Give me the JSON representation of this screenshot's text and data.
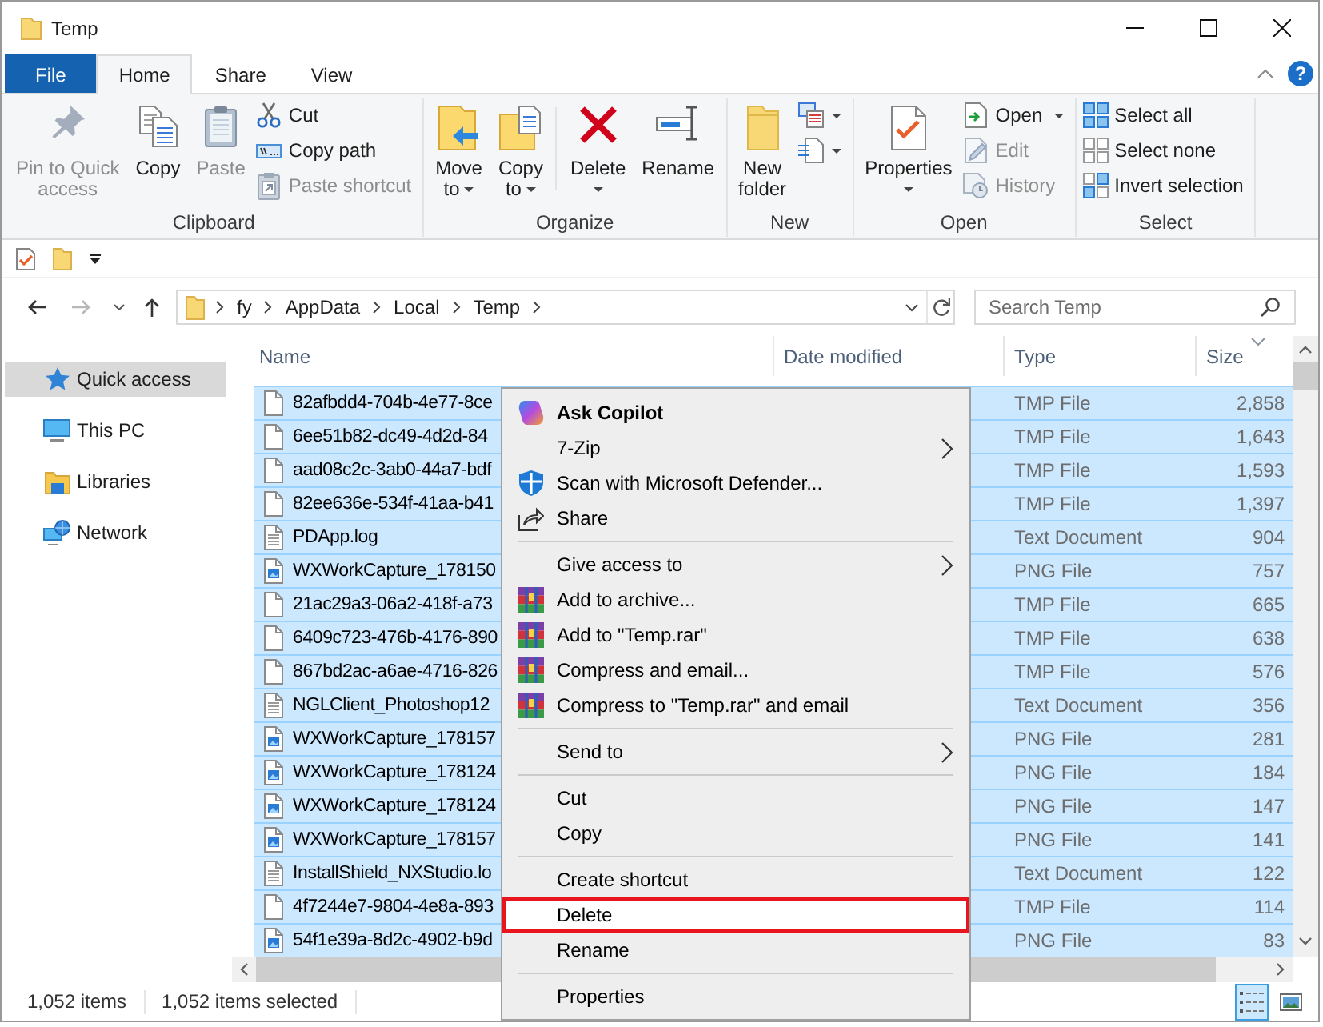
{
  "window": {
    "title": "Temp"
  },
  "ribbon": {
    "tabs": [
      {
        "label": "File",
        "kind": "menu",
        "selected": false
      },
      {
        "label": "Home",
        "kind": "tab",
        "selected": true
      },
      {
        "label": "Share",
        "kind": "tab",
        "selected": false
      },
      {
        "label": "View",
        "kind": "tab",
        "selected": false
      }
    ],
    "help": "?",
    "groups": [
      {
        "label": "Clipboard",
        "controls": [
          {
            "kind": "large",
            "label": "Pin to Quick access",
            "disabled": true
          },
          {
            "kind": "large",
            "label": "Copy",
            "disabled": false
          },
          {
            "kind": "large",
            "label": "Paste",
            "disabled": true
          },
          {
            "kind": "stack",
            "items": [
              {
                "label": "Cut",
                "disabled": false
              },
              {
                "label": "Copy path",
                "disabled": false
              },
              {
                "label": "Paste shortcut",
                "disabled": true
              }
            ]
          }
        ]
      },
      {
        "label": "Organize",
        "controls": [
          {
            "kind": "large",
            "label": "Move to",
            "dropdown": true,
            "disabled": false
          },
          {
            "kind": "large",
            "label": "Copy to",
            "dropdown": true,
            "disabled": false
          },
          {
            "kind": "divider"
          },
          {
            "kind": "large",
            "label": "Delete",
            "dropdown": true,
            "disabled": false
          },
          {
            "kind": "large",
            "label": "Rename",
            "dropdown": false,
            "disabled": false
          }
        ]
      },
      {
        "label": "New",
        "controls": [
          {
            "kind": "large",
            "label": "New folder",
            "dropdown": false,
            "disabled": false
          },
          {
            "kind": "icons",
            "items": [
              {
                "dropdown": true
              },
              {
                "dropdown": true
              }
            ]
          }
        ]
      },
      {
        "label": "Open",
        "controls": [
          {
            "kind": "large",
            "label": "Properties",
            "dropdown": true,
            "disabled": false
          },
          {
            "kind": "stack",
            "items": [
              {
                "label": "Open",
                "dropdown": true,
                "disabled": false
              },
              {
                "label": "Edit",
                "disabled": true
              },
              {
                "label": "History",
                "disabled": true
              }
            ]
          }
        ]
      },
      {
        "label": "Select",
        "controls": [
          {
            "kind": "stack",
            "items": [
              {
                "label": "Select all",
                "disabled": false
              },
              {
                "label": "Select none",
                "disabled": false
              },
              {
                "label": "Invert selection",
                "disabled": false
              }
            ]
          }
        ]
      }
    ]
  },
  "address_bar": {
    "crumbs": [
      "fy",
      "AppData",
      "Local",
      "Temp"
    ]
  },
  "search": {
    "placeholder": "Search Temp"
  },
  "nav_pane": {
    "items": [
      {
        "label": "Quick access",
        "selected": true
      },
      {
        "label": "This PC",
        "selected": false
      },
      {
        "label": "Libraries",
        "selected": false
      },
      {
        "label": "Network",
        "selected": false
      }
    ]
  },
  "file_list": {
    "columns": [
      {
        "label": "Name",
        "sorted": false
      },
      {
        "label": "Date modified",
        "sorted": false
      },
      {
        "label": "Type",
        "sorted": false
      },
      {
        "label": "Size",
        "sorted": true
      }
    ],
    "rows": [
      {
        "name": "82afbdd4-704b-4e77-8ce",
        "type": "TMP File",
        "size": "2,858",
        "kind": "plain",
        "selected": true
      },
      {
        "name": "6ee51b82-dc49-4d2d-84",
        "type": "TMP File",
        "size": "1,643",
        "kind": "plain",
        "selected": true
      },
      {
        "name": "aad08c2c-3ab0-44a7-bdf",
        "type": "TMP File",
        "size": "1,593",
        "kind": "plain",
        "selected": true
      },
      {
        "name": "82ee636e-534f-41aa-b41",
        "type": "TMP File",
        "size": "1,397",
        "kind": "plain",
        "selected": true
      },
      {
        "name": "PDApp.log",
        "type": "Text Document",
        "size": "904",
        "kind": "text",
        "selected": true
      },
      {
        "name": "WXWorkCapture_178150",
        "type": "PNG File",
        "size": "757",
        "kind": "image",
        "selected": true
      },
      {
        "name": "21ac29a3-06a2-418f-a73",
        "type": "TMP File",
        "size": "665",
        "kind": "plain",
        "selected": true
      },
      {
        "name": "6409c723-476b-4176-890",
        "type": "TMP File",
        "size": "638",
        "kind": "plain",
        "selected": true
      },
      {
        "name": "867bd2ac-a6ae-4716-826",
        "type": "TMP File",
        "size": "576",
        "kind": "plain",
        "selected": true
      },
      {
        "name": "NGLClient_Photoshop12",
        "type": "Text Document",
        "size": "356",
        "kind": "text",
        "selected": true
      },
      {
        "name": "WXWorkCapture_178157",
        "type": "PNG File",
        "size": "281",
        "kind": "image",
        "selected": true
      },
      {
        "name": "WXWorkCapture_178124",
        "type": "PNG File",
        "size": "184",
        "kind": "image",
        "selected": true
      },
      {
        "name": "WXWorkCapture_178124",
        "type": "PNG File",
        "size": "147",
        "kind": "image",
        "selected": true
      },
      {
        "name": "WXWorkCapture_178157",
        "type": "PNG File",
        "size": "141",
        "kind": "image",
        "selected": true
      },
      {
        "name": "InstallShield_NXStudio.lo",
        "type": "Text Document",
        "size": "122",
        "kind": "text",
        "selected": true
      },
      {
        "name": "4f7244e7-9804-4e8a-893",
        "type": "TMP File",
        "size": "114",
        "kind": "plain",
        "selected": true
      },
      {
        "name": "54f1e39a-8d2c-4902-b9d",
        "type": "PNG File",
        "size": "83",
        "kind": "image",
        "selected": true
      }
    ]
  },
  "context_menu": {
    "items": [
      {
        "kind": "item",
        "label": "Ask Copilot",
        "default": true,
        "submenu": false,
        "highlighted": false
      },
      {
        "kind": "item",
        "label": "7-Zip",
        "default": false,
        "submenu": true,
        "highlighted": false
      },
      {
        "kind": "item",
        "label": "Scan with Microsoft Defender...",
        "default": false,
        "submenu": false,
        "highlighted": false
      },
      {
        "kind": "item",
        "label": "Share",
        "default": false,
        "submenu": false,
        "highlighted": false
      },
      {
        "kind": "separator"
      },
      {
        "kind": "item",
        "label": "Give access to",
        "default": false,
        "submenu": true,
        "highlighted": false
      },
      {
        "kind": "item",
        "label": "Add to archive...",
        "default": false,
        "submenu": false,
        "highlighted": false
      },
      {
        "kind": "item",
        "label": "Add to \"Temp.rar\"",
        "default": false,
        "submenu": false,
        "highlighted": false
      },
      {
        "kind": "item",
        "label": "Compress and email...",
        "default": false,
        "submenu": false,
        "highlighted": false
      },
      {
        "kind": "item",
        "label": "Compress to \"Temp.rar\" and email",
        "default": false,
        "submenu": false,
        "highlighted": false
      },
      {
        "kind": "separator"
      },
      {
        "kind": "item",
        "label": "Send to",
        "default": false,
        "submenu": true,
        "highlighted": false
      },
      {
        "kind": "separator"
      },
      {
        "kind": "item",
        "label": "Cut",
        "default": false,
        "submenu": false,
        "highlighted": false
      },
      {
        "kind": "item",
        "label": "Copy",
        "default": false,
        "submenu": false,
        "highlighted": false
      },
      {
        "kind": "separator"
      },
      {
        "kind": "item",
        "label": "Create shortcut",
        "default": false,
        "submenu": false,
        "highlighted": false
      },
      {
        "kind": "item",
        "label": "Delete",
        "default": false,
        "submenu": false,
        "highlighted": true
      },
      {
        "kind": "item",
        "label": "Rename",
        "default": false,
        "submenu": false,
        "highlighted": false
      },
      {
        "kind": "separator"
      },
      {
        "kind": "item",
        "label": "Properties",
        "default": false,
        "submenu": false,
        "highlighted": false
      }
    ]
  },
  "status_bar": {
    "item_count": "1,052 items",
    "selection": "1,052 items selected",
    "views": [
      {
        "kind": "details",
        "selected": true
      },
      {
        "kind": "large_icons",
        "selected": false
      }
    ]
  }
}
